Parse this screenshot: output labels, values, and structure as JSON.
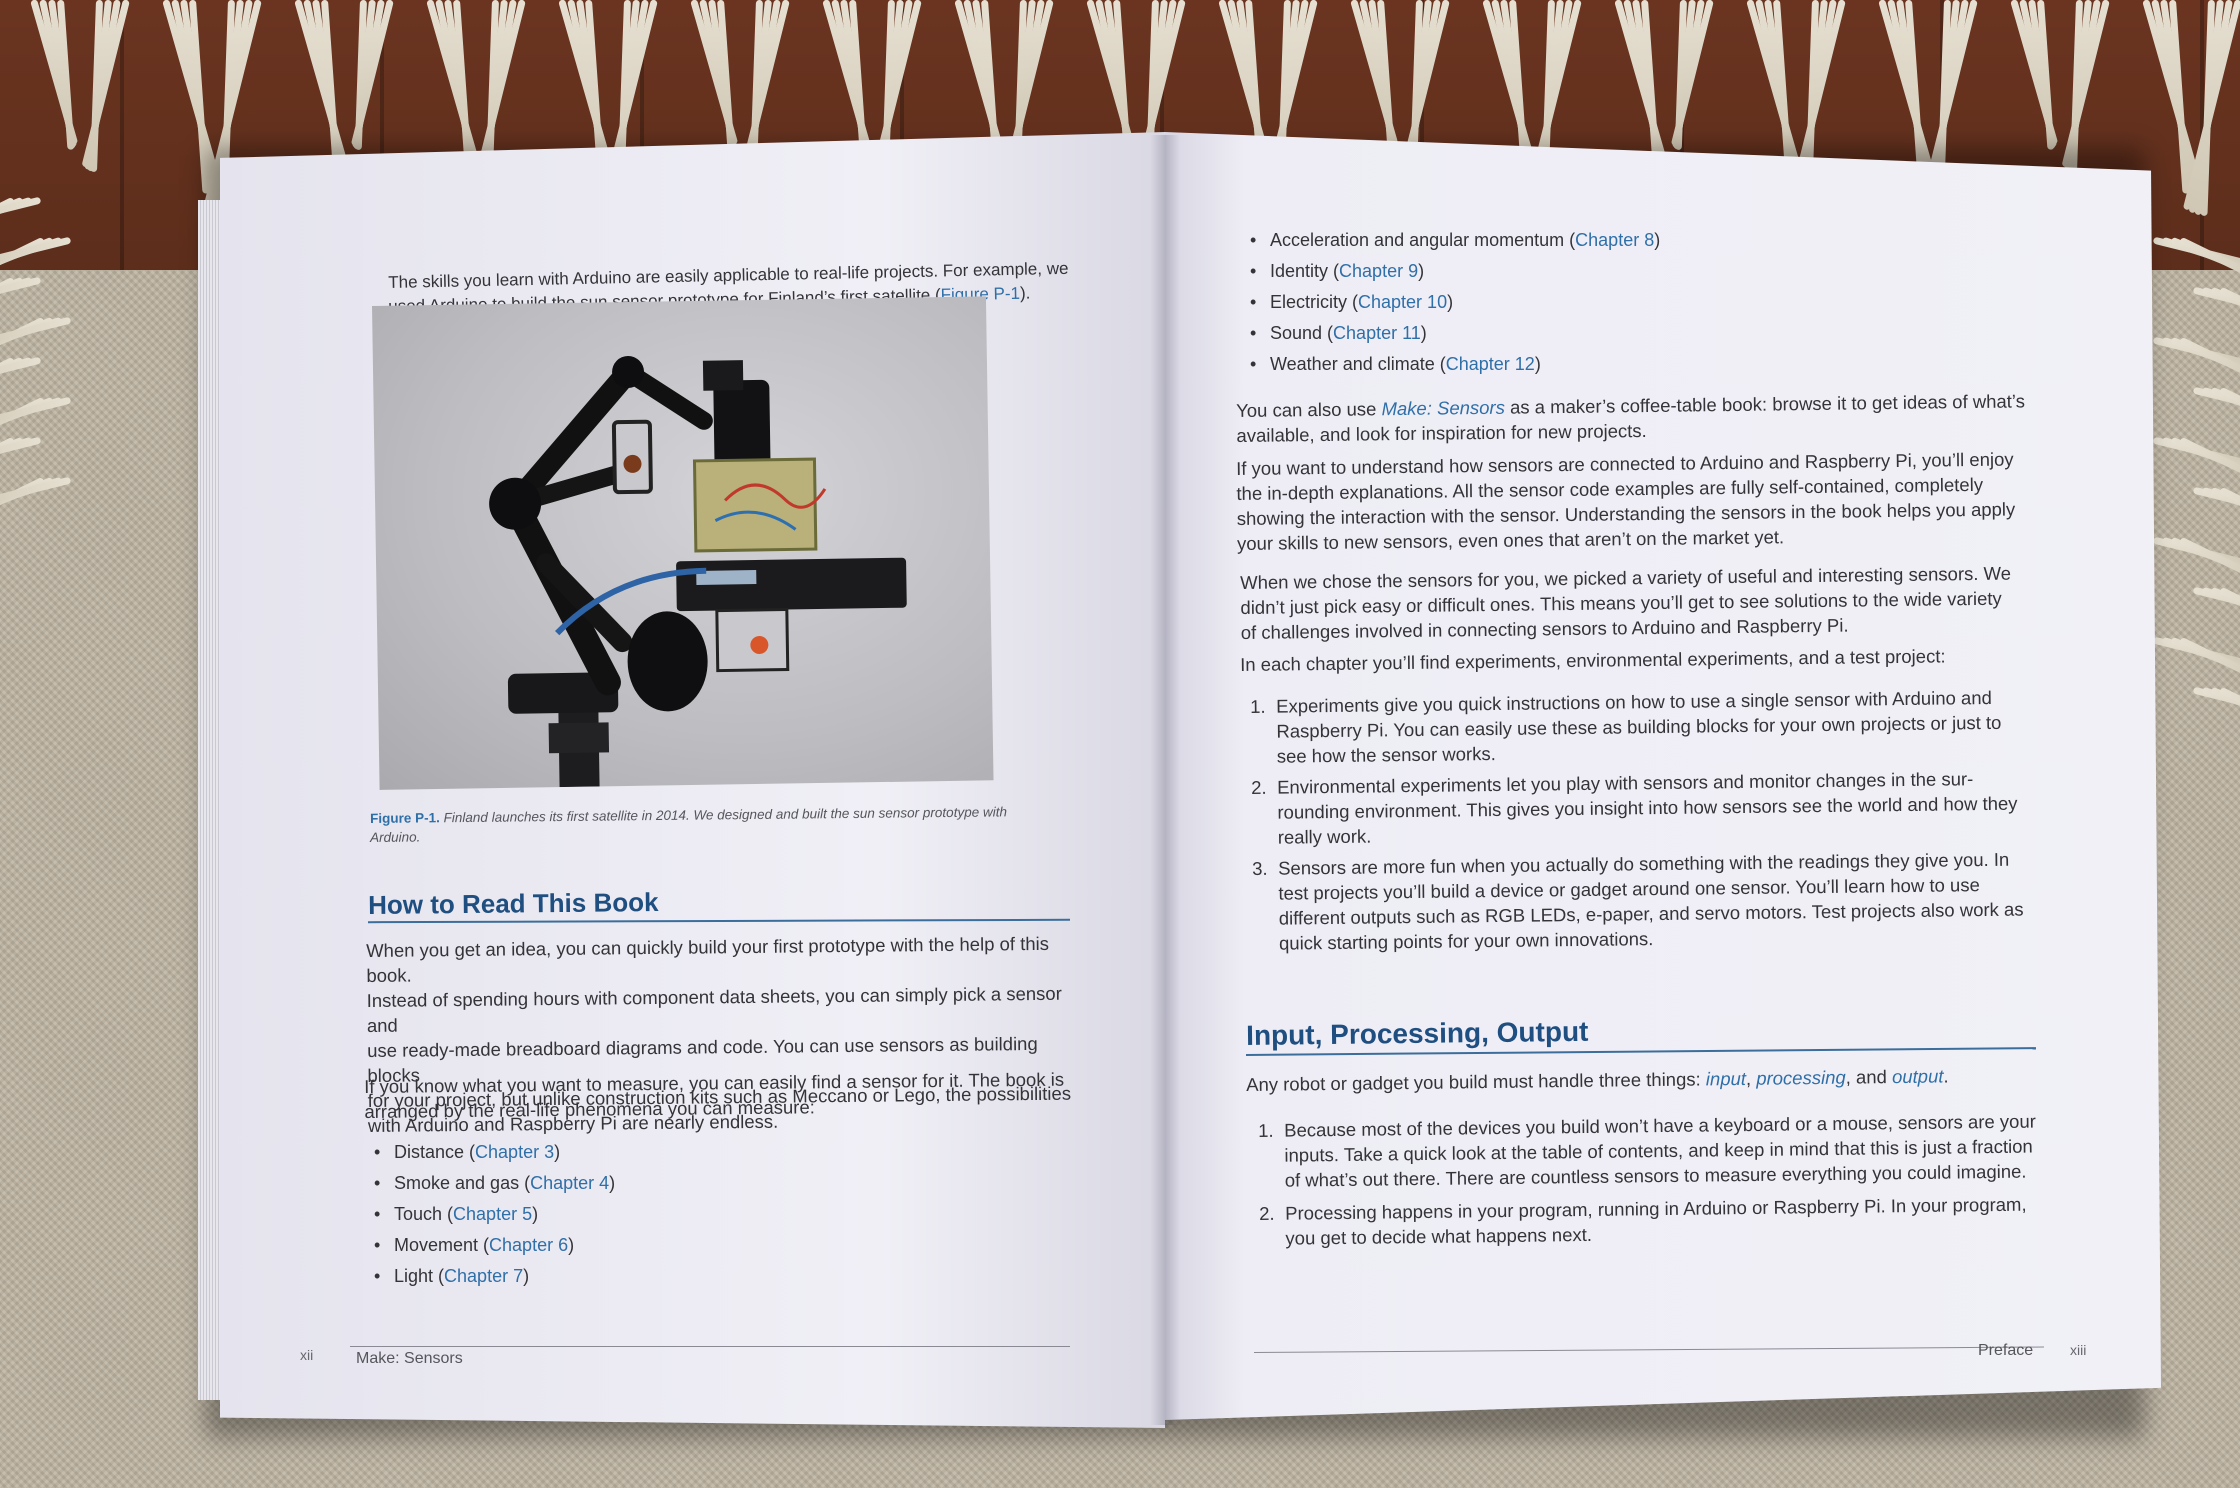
{
  "left_page": {
    "intro_line_1": "The skills you learn with Arduino are easily applicable to real-life projects. For example, we",
    "intro_line_2_pre": "used Arduino to build the sun sensor prototype for Finland’s first satellite (",
    "intro_line_2_link": "Figure P-1",
    "intro_line_2_post": ").",
    "figure_label": "Figure P-1.",
    "figure_caption": "Finland launches its first satellite in 2014. We designed and built the sun sensor prototype with",
    "figure_caption_2": "Arduino.",
    "section_heading": "How to Read This Book",
    "para1_lines": [
      "When you get an idea, you can quickly build your first prototype with the help of this book.",
      "Instead of spending hours with component data sheets, you can simply pick a sensor and",
      "use ready-made breadboard diagrams and code. You can use sensors as building blocks",
      "for your project, but unlike construction kits such as Meccano or Lego, the possibilities",
      "with Arduino and Raspberry Pi are nearly endless."
    ],
    "para2_lines": [
      "If you know what you want to measure, you can easily find a sensor for it. The book is",
      "arranged by the real-life phenomena you can measure:"
    ],
    "bullets": [
      {
        "text": "Distance (",
        "link": "Chapter 3",
        "end": ")"
      },
      {
        "text": "Smoke and gas (",
        "link": "Chapter 4",
        "end": ")"
      },
      {
        "text": "Touch (",
        "link": "Chapter 5",
        "end": ")"
      },
      {
        "text": "Movement (",
        "link": "Chapter 6",
        "end": ")"
      },
      {
        "text": "Light (",
        "link": "Chapter 7",
        "end": ")"
      }
    ],
    "footer_page_number": "xii",
    "footer_title": "Make: Sensors"
  },
  "right_page": {
    "bullets": [
      {
        "text": "Acceleration and angular momentum (",
        "link": "Chapter 8",
        "end": ")"
      },
      {
        "text": "Identity (",
        "link": "Chapter 9",
        "end": ")"
      },
      {
        "text": "Electricity (",
        "link": "Chapter 10",
        "end": ")"
      },
      {
        "text": "Sound (",
        "link": "Chapter 11",
        "end": ")"
      },
      {
        "text": "Weather and climate (",
        "link": "Chapter 12",
        "end": ")"
      }
    ],
    "para1_pre": "You can also use ",
    "para1_link": "Make: Sensors",
    "para1_post": " as a maker’s coffee-table book: browse it to get ideas of what’s",
    "para1_line2": "available, and look for inspiration for new projects.",
    "para2_lines": [
      "If you want to understand how sensors are connected to Arduino and Raspberry Pi, you’ll enjoy",
      "the in-depth explanations. All the sensor code examples are fully self-contained, completely",
      "showing the interaction with the sensor. Understanding the sensors in the book helps you apply",
      "your skills to new sensors, even ones that aren’t on the market yet."
    ],
    "para3_lines": [
      "When we chose the sensors for you, we picked a variety of useful and interesting sensors. We",
      "didn’t just pick easy or difficult ones. This means you’ll get to see solutions to the wide variety",
      "of challenges involved in connecting sensors to Arduino and Raspberry Pi."
    ],
    "para4": "In each chapter you’ll find experiments, environmental experiments, and a test project:",
    "numbered": [
      {
        "n": "1.",
        "lines": [
          "Experiments give you quick instructions on how to use a single sensor with Arduino and",
          "Raspberry Pi. You can easily use these as building blocks for your own projects or just to",
          "see how the sensor works."
        ]
      },
      {
        "n": "2.",
        "lines": [
          "Environmental experiments let you play with sensors and monitor changes in the sur-",
          "rounding environment. This gives you insight into how sensors see the world and how they",
          "really work."
        ]
      },
      {
        "n": "3.",
        "lines": [
          "Sensors are more fun when you actually do something with the readings they give you. In",
          "test projects you’ll build a device or gadget around one sensor. You’ll learn how to use",
          "different outputs such as RGB LEDs, e-paper, and servo motors. Test projects also work as",
          "quick starting points for your own innovations."
        ]
      }
    ],
    "section_heading": "Input, Processing, Output",
    "intro_pre": "Any robot or gadget you build must handle three things: ",
    "intro_input": "input",
    "intro_processing": "processing",
    "intro_output": "output",
    "numbered2": [
      {
        "n": "1.",
        "lines": [
          "Because most of the devices you build won’t have a keyboard or a mouse, sensors are your",
          "inputs. Take a quick look at the table of contents, and keep in mind that this is just a fraction",
          "of what’s out there. There are countless sensors to measure everything you could imagine."
        ]
      },
      {
        "n": "2.",
        "lines": [
          "Processing happens in your program, running in Arduino or Raspberry Pi. In your program,",
          "you get to decide what happens next."
        ]
      }
    ],
    "footer_title": "Preface",
    "footer_page_number": "xiii"
  },
  "colors": {
    "link_blue": "#2f6fa8",
    "heading_blue": "#1f4f80",
    "body_text": "#333338"
  }
}
